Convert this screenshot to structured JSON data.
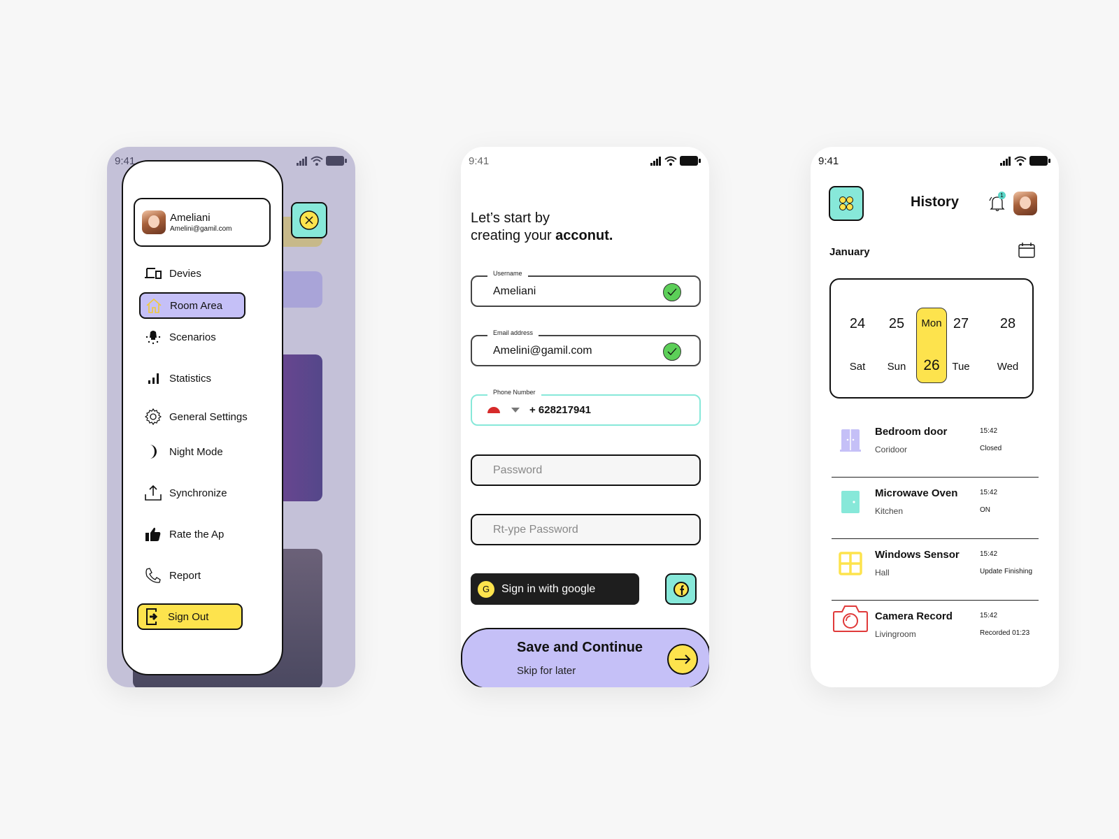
{
  "status_bar": {
    "time": "9:41"
  },
  "menu_screen": {
    "profile": {
      "name": "Ameliani",
      "email": "Amelini@gamil.com"
    },
    "items": [
      {
        "label": "Devies",
        "icon": "devices-icon"
      },
      {
        "label": "Room Area",
        "icon": "home-icon",
        "active": true
      },
      {
        "label": "Scenarios",
        "icon": "bulb-icon"
      },
      {
        "label": "Statistics",
        "icon": "bar-chart-icon"
      },
      {
        "label": "General Settings",
        "icon": "gear-icon"
      },
      {
        "label": "Night Mode",
        "icon": "moon-icon"
      },
      {
        "label": "Synchronize",
        "icon": "upload-icon"
      },
      {
        "label": "Rate the Ap",
        "icon": "thumbs-up-icon"
      },
      {
        "label": "Report",
        "icon": "phone-icon"
      }
    ],
    "sign_out_label": "Sign Out"
  },
  "signup_screen": {
    "headline_line1": "Let’s start by",
    "headline_line2_prefix": "creating your ",
    "headline_line2_bold": "acconut.",
    "username": {
      "label": "Username",
      "value": "Ameliani",
      "valid": true
    },
    "email": {
      "label": "Email address",
      "value": "Amelini@gamil.com",
      "valid": true
    },
    "phone": {
      "label": "Phone Number",
      "value": "+ 628217941"
    },
    "password": {
      "placeholder": "Password"
    },
    "retype_password": {
      "placeholder": "Rt-ype Password"
    },
    "google_button": {
      "icon_letter": "G",
      "label": "Sign in with google"
    },
    "save_button": {
      "label": "Save and Continue"
    },
    "skip_link": {
      "label": "Skip for later"
    }
  },
  "history_screen": {
    "title": "History",
    "notification_count": "1",
    "month": "January",
    "days": [
      {
        "num": "24",
        "name": "Sat"
      },
      {
        "num": "25",
        "name": "Sun"
      },
      {
        "num": "26",
        "name": "Mon",
        "selected": true
      },
      {
        "num": "27",
        "name": "Tue"
      },
      {
        "num": "28",
        "name": "Wed"
      }
    ],
    "items": [
      {
        "title": "Bedroom door",
        "location": "Coridoor",
        "time": "15:42",
        "status": "Closed",
        "icon": "door-icon"
      },
      {
        "title": "Microwave Oven",
        "location": "Kitchen",
        "time": "15:42",
        "status": "ON",
        "icon": "oven-icon"
      },
      {
        "title": "Windows Sensor",
        "location": "Hall",
        "time": "15:42",
        "status": "Update Finishing",
        "icon": "window-icon"
      },
      {
        "title": "Camera Record",
        "location": "Livingroom",
        "time": "15:42",
        "status": "Recorded 01:23",
        "icon": "camera-icon"
      }
    ]
  },
  "colors": {
    "mint": "#87e8d9",
    "yellow": "#fde34d",
    "lavender": "#c5c0f7",
    "success": "#5ccf58",
    "camera_red": "#e03a3a"
  }
}
